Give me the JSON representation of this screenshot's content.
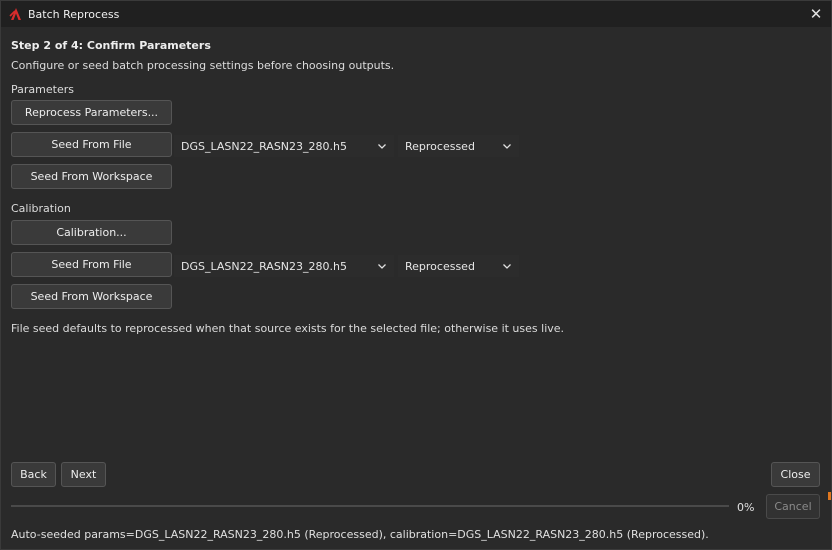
{
  "window": {
    "title": "Batch Reprocess",
    "accent": "#d82c2c"
  },
  "header": {
    "step": "Step 2 of 4: Confirm Parameters",
    "description": "Configure or seed batch processing settings before choosing outputs."
  },
  "parameters": {
    "section_label": "Parameters",
    "main_button": "Reprocess Parameters...",
    "seed_file_button": "Seed From File",
    "file_select": "DGS_LASN22_RASN23_280.h5",
    "source_select": "Reprocessed",
    "seed_workspace_button": "Seed From Workspace"
  },
  "calibration": {
    "section_label": "Calibration",
    "main_button": "Calibration...",
    "seed_file_button": "Seed From File",
    "file_select": "DGS_LASN22_RASN23_280.h5",
    "source_select": "Reprocessed",
    "seed_workspace_button": "Seed From Workspace"
  },
  "hint": "File seed defaults to reprocessed when that source exists for the selected file; otherwise it uses live.",
  "nav": {
    "back": "Back",
    "next": "Next",
    "close": "Close",
    "cancel": "Cancel"
  },
  "progress": {
    "value": 0,
    "label": "0%"
  },
  "status": "Auto-seeded params=DGS_LASN22_RASN23_280.h5 (Reprocessed), calibration=DGS_LASN22_RASN23_280.h5 (Reprocessed)."
}
